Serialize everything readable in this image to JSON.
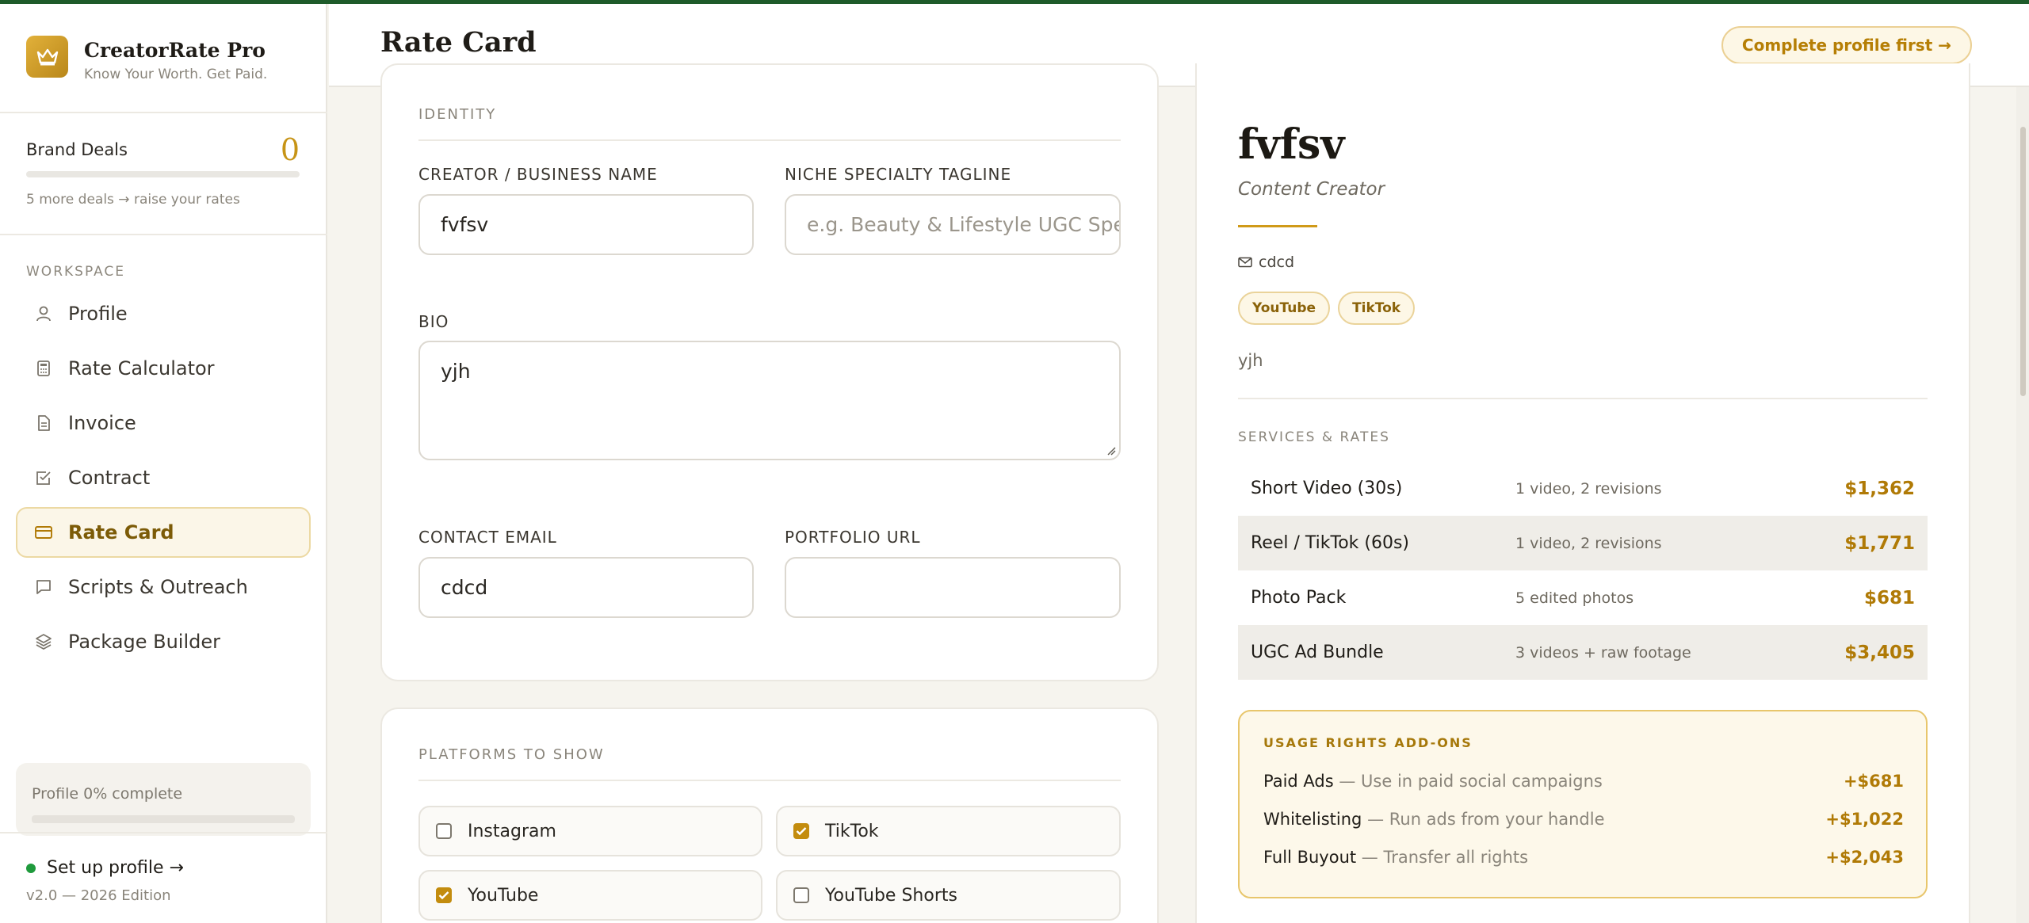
{
  "brand": {
    "name": "CreatorRate Pro",
    "tagline": "Know Your Worth. Get Paid."
  },
  "deals": {
    "label": "Brand Deals",
    "count": "0",
    "hint": "5 more deals → raise your rates",
    "progress": 0
  },
  "sidebar": {
    "section_label": "WORKSPACE",
    "items": [
      {
        "label": "Profile",
        "icon": "user-icon"
      },
      {
        "label": "Rate Calculator",
        "icon": "calculator-icon"
      },
      {
        "label": "Invoice",
        "icon": "document-icon"
      },
      {
        "label": "Contract",
        "icon": "checkbox-icon"
      },
      {
        "label": "Rate Card",
        "icon": "card-icon",
        "active": true
      },
      {
        "label": "Scripts & Outreach",
        "icon": "chat-icon"
      },
      {
        "label": "Package Builder",
        "icon": "layers-icon"
      }
    ],
    "profile_status": "Profile 0% complete",
    "profile_progress": 0,
    "setup_label": "Set up profile →",
    "version": "v2.0 — 2026 Edition"
  },
  "header": {
    "title": "Rate Card",
    "cta": "Complete profile first →"
  },
  "form": {
    "identity_label": "IDENTITY",
    "name_label": "CREATOR / BUSINESS NAME",
    "name_value": "fvfsv",
    "tagline_label": "NICHE SPECIALTY TAGLINE",
    "tagline_placeholder": "e.g. Beauty & Lifestyle UGC Spe",
    "bio_label": "BIO",
    "bio_value": "yjh",
    "email_label": "CONTACT EMAIL",
    "email_value": "cdcd",
    "portfolio_label": "PORTFOLIO URL",
    "portfolio_value": "",
    "platforms_label": "PLATFORMS TO SHOW",
    "platforms": [
      {
        "label": "Instagram",
        "checked": false
      },
      {
        "label": "TikTok",
        "checked": true
      },
      {
        "label": "YouTube",
        "checked": true
      },
      {
        "label": "YouTube Shorts",
        "checked": false
      }
    ]
  },
  "preview": {
    "name": "fvfsv",
    "role": "Content Creator",
    "email": "cdcd",
    "tags": [
      "YouTube",
      "TikTok"
    ],
    "bio": "yjh",
    "services_label": "SERVICES & RATES",
    "services": [
      {
        "name": "Short Video (30s)",
        "detail": "1 video, 2 revisions",
        "price": "$1,362"
      },
      {
        "name": "Reel / TikTok (60s)",
        "detail": "1 video, 2 revisions",
        "price": "$1,771"
      },
      {
        "name": "Photo Pack",
        "detail": "5 edited photos",
        "price": "$681"
      },
      {
        "name": "UGC Ad Bundle",
        "detail": "3 videos + raw footage",
        "price": "$3,405"
      }
    ],
    "addons_label": "USAGE RIGHTS ADD-ONS",
    "addons": [
      {
        "name": "Paid Ads",
        "desc": " — Use in paid social campaigns",
        "price": "+$681"
      },
      {
        "name": "Whitelisting",
        "desc": " — Run ads from your handle",
        "price": "+$1,022"
      },
      {
        "name": "Full Buyout",
        "desc": " — Transfer all rights",
        "price": "+$2,043"
      }
    ]
  },
  "colors": {
    "accent": "#c79416",
    "brand_green": "#1e5b2a",
    "active_bg": "#fbf6e8"
  }
}
